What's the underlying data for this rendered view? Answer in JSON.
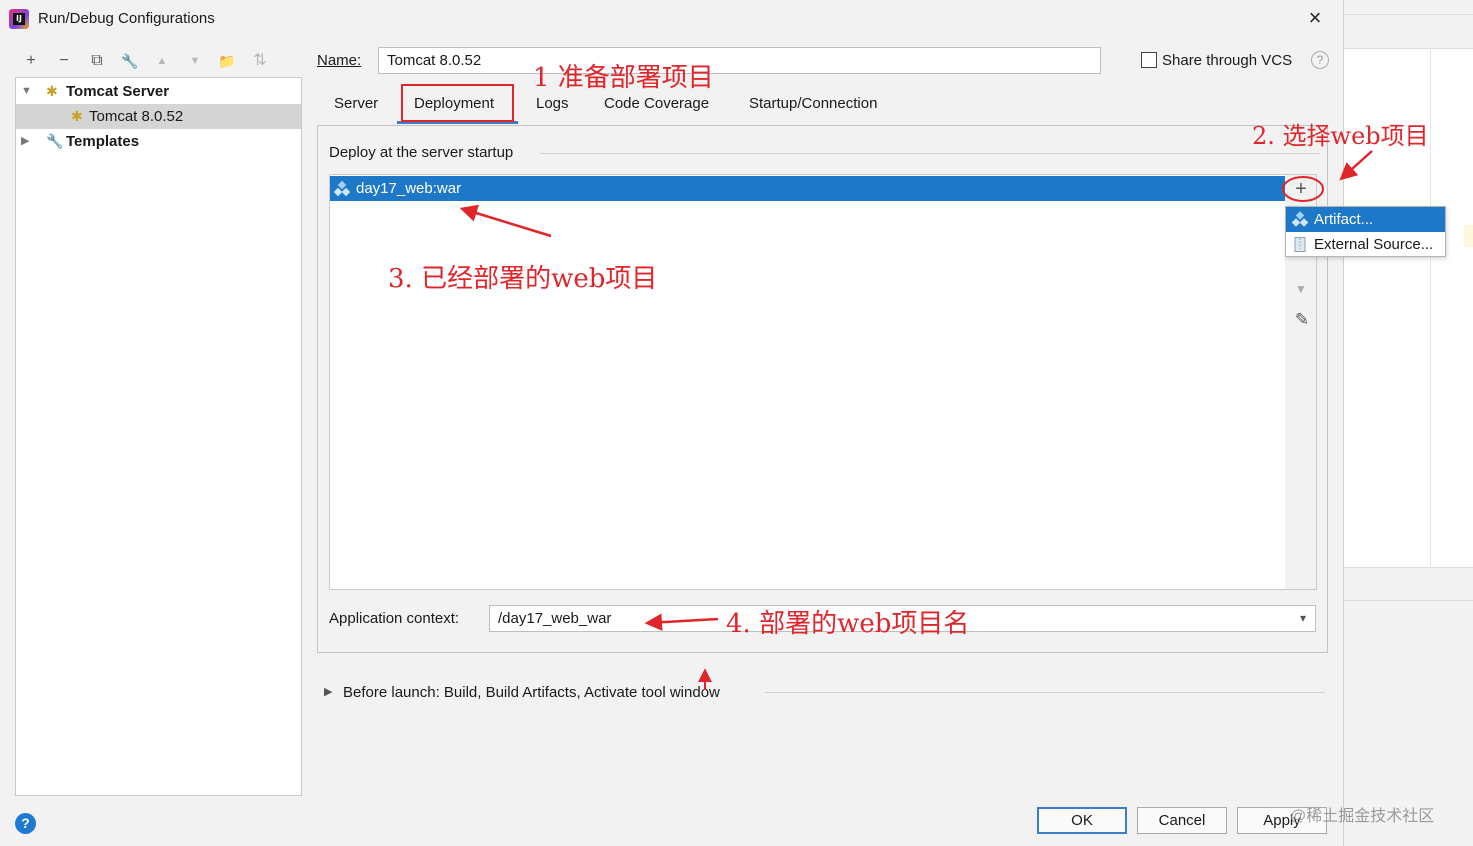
{
  "window": {
    "title": "Run/Debug Configurations",
    "close_glyph": "×"
  },
  "toolbar": {
    "add": "+",
    "remove": "−",
    "copy": "⧉",
    "wrench": "🔧",
    "move_up": "▲",
    "move_down": "▼",
    "folder": "📁",
    "sort": "⇅"
  },
  "tree": {
    "items": [
      {
        "label": "Tomcat Server",
        "bold": true,
        "expanded": true
      },
      {
        "label": "Tomcat 8.0.52",
        "selected": true
      },
      {
        "label": "Templates",
        "bold": true,
        "expanded": false
      }
    ]
  },
  "form": {
    "name_label": "Name:",
    "name_value": "Tomcat 8.0.52",
    "share_label": "Share through VCS",
    "share_checked": false,
    "help_glyph": "?"
  },
  "tabs": [
    {
      "label": "Server"
    },
    {
      "label": "Deployment",
      "active": true
    },
    {
      "label": "Logs"
    },
    {
      "label": "Code Coverage"
    },
    {
      "label": "Startup/Connection"
    }
  ],
  "deployment": {
    "section_label": "Deploy at the server startup",
    "items": [
      "day17_web:war"
    ],
    "add_glyph": "+",
    "down_glyph": "▼",
    "edit_glyph": "✎",
    "popup": [
      "Artifact...",
      "External Source..."
    ]
  },
  "context": {
    "label": "Application context:",
    "value": "/day17_web_war",
    "chevron": "⌄"
  },
  "before_launch": {
    "label": "Before launch: Build, Build Artifacts, Activate tool window"
  },
  "buttons": {
    "ok": "OK",
    "cancel": "Cancel",
    "apply": "Apply",
    "help": "?"
  },
  "annotations": {
    "step1": "1 准备部署项目",
    "step2": "2. 选择web项目",
    "step3": "3. 已经部署的web项目",
    "step4": "4. 部署的web项目名",
    "color": "#e0262b"
  },
  "watermark": "@稀土掘金技术社区",
  "colors": {
    "selection": "#1e78c8",
    "tab_underline": "#3d7ec9",
    "help_blue": "#1f7ad4"
  }
}
